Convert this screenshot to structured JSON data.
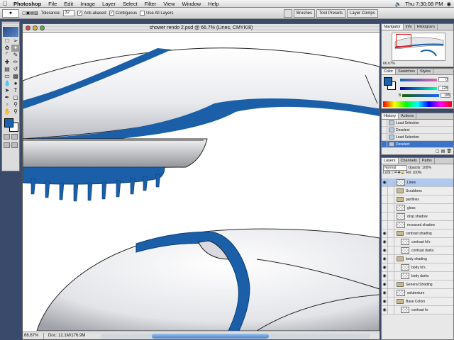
{
  "menubar": {
    "apple": "",
    "items": [
      "Photoshop",
      "File",
      "Edit",
      "Image",
      "Layer",
      "Select",
      "Filter",
      "View",
      "Window",
      "Help"
    ],
    "clock": "Thu 7:30:08 PM"
  },
  "options": {
    "tolerance_label": "Tolerance:",
    "tolerance_value": "32",
    "anti_aliased": "Anti-aliased",
    "contiguous": "Contiguous",
    "use_all_layers": "Use All Layers"
  },
  "palette_well": [
    "Brushes",
    "Tool Presets",
    "Layer Comps"
  ],
  "document": {
    "title": "shower rendo 2.psd @ 66.7% (Lines, CMYK/8)",
    "zoom": "66.67%",
    "doc_info": "Doc: 12.1M/176.9M",
    "scroll_position": 0.3
  },
  "navigator": {
    "tabs": [
      "Navigator",
      "Info",
      "Histogram"
    ],
    "zoom": "66.67%"
  },
  "color": {
    "tabs": [
      "Color",
      "Swatches",
      "Styles"
    ],
    "foreground": "#1a62ae",
    "background": "#ffffff",
    "sliders": [
      {
        "label": "",
        "value": "0"
      },
      {
        "label": "",
        "value": "128"
      },
      {
        "label": "B",
        "value": "195"
      }
    ]
  },
  "history": {
    "tabs": [
      "History",
      "Actions"
    ],
    "items": [
      "Load Selection",
      "Deselect",
      "Load Selection",
      "Deselect"
    ],
    "selected_index": 3
  },
  "layers": {
    "tabs": [
      "Layers",
      "Channels",
      "Paths"
    ],
    "blend_mode": "Normal",
    "opacity_label": "Opacity:",
    "opacity": "100%",
    "lock_label": "Lock:",
    "fill_label": "Fill:",
    "fill": "100%",
    "rows": [
      {
        "name": "Lines",
        "type": "layer",
        "visible": true,
        "selected": true,
        "indent": false
      },
      {
        "name": "Scrubbers",
        "type": "group",
        "visible": false,
        "selected": false,
        "indent": false
      },
      {
        "name": "partlines",
        "type": "group",
        "visible": false,
        "selected": false,
        "indent": false
      },
      {
        "name": "gloss",
        "type": "layer",
        "visible": false,
        "selected": false,
        "indent": false
      },
      {
        "name": "drop shadow",
        "type": "layer",
        "visible": false,
        "selected": false,
        "indent": false
      },
      {
        "name": "recessed shadow",
        "type": "layer",
        "visible": false,
        "selected": false,
        "indent": false
      },
      {
        "name": "contrast shading",
        "type": "group",
        "visible": true,
        "selected": false,
        "indent": false
      },
      {
        "name": "contrast hi's",
        "type": "layer",
        "visible": true,
        "selected": false,
        "indent": true
      },
      {
        "name": "contrast darks",
        "type": "layer",
        "visible": true,
        "selected": false,
        "indent": true
      },
      {
        "name": "body shading",
        "type": "group",
        "visible": true,
        "selected": false,
        "indent": false
      },
      {
        "name": "body hi's",
        "type": "layer",
        "visible": true,
        "selected": false,
        "indent": true
      },
      {
        "name": "body darks",
        "type": "layer",
        "visible": true,
        "selected": false,
        "indent": true
      },
      {
        "name": "General Shading",
        "type": "group",
        "visible": true,
        "selected": false,
        "indent": false
      },
      {
        "name": "solutexture",
        "type": "layer",
        "visible": true,
        "selected": false,
        "indent": false
      },
      {
        "name": "Base Colors",
        "type": "group",
        "visible": true,
        "selected": false,
        "indent": false
      },
      {
        "name": "contrast fo",
        "type": "layer",
        "visible": true,
        "selected": false,
        "indent": true
      }
    ]
  }
}
